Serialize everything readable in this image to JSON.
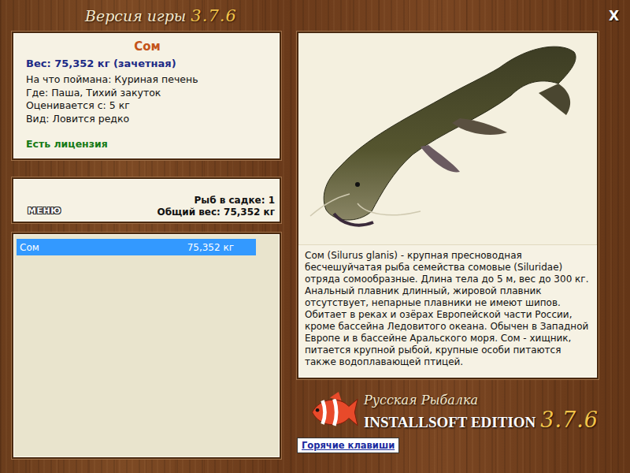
{
  "window": {
    "title": "Версия игры",
    "version": "3.7.6",
    "close": "X"
  },
  "fish": {
    "name": "Сом",
    "weight": "Вес: 75,352 кг (зачетная)",
    "details": [
      "На что поймана: Куриная печень",
      "Где: Паша, Тихий закуток",
      "Оценивается с: 5 кг",
      "Вид: Ловится редко"
    ],
    "license": "Есть лицензия"
  },
  "summary": {
    "menu": "МЕНЮ",
    "count": "Рыб в садке: 1",
    "total": "Общий вес: 75,352 кг"
  },
  "catch_list": [
    {
      "name": "Сом",
      "weight": "75,352 кг",
      "selected": true
    }
  ],
  "description": "Сом (Silurus glanis) - крупная пресноводная бесчешуйчатая рыба семейства сомовые (Siluridae) отряда сомообразные. Длина тела до 5 м, вес до 300 кг. Анальный плавник длинный, жировой плавник отсутствует, непарные плавники не имеют шипов. Обитает в реках и озёрах Европейской части России, кроме бассейна Ледовитого океана. Обычен в Западной Европе и в бассейне Аральского моря. Сом - хищник, питается крупной рыбой, крупные особи питаются также водоплавающей птицей.",
  "logo": {
    "title": "Русская Рыбалка",
    "edition": "INSTALLSOFT EDITION",
    "version": "3.7.6"
  },
  "hotkeys_button": "Горячие клавиши"
}
